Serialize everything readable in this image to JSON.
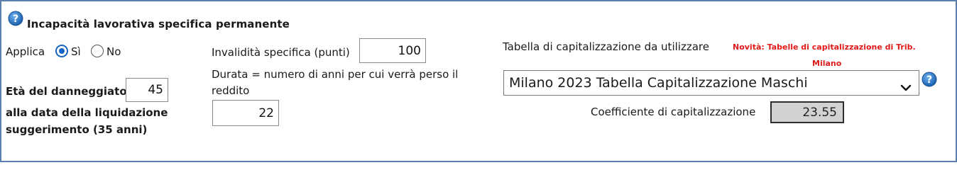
{
  "section": {
    "title": "Incapacità lavorativa specifica permanente"
  },
  "applica": {
    "label": "Applica",
    "options": [
      {
        "label": "Sì",
        "selected": true
      },
      {
        "label": "No",
        "selected": false
      }
    ]
  },
  "eta": {
    "label": "Età del danneggiato",
    "value": "45",
    "label2": "alla data della liquidazione",
    "hint": "suggerimento (35 anni)"
  },
  "invalidita": {
    "label": "Invalidità specifica (punti)",
    "value": "100"
  },
  "durata": {
    "label_line1": "Durata = numero di anni per cui verrà perso il",
    "label_line2": "reddito",
    "value": "22"
  },
  "tabella": {
    "label": "Tabella di capitalizzazione da utilizzare",
    "novita_line1": "Novità: Tabelle di capitalizzazione di Trib.",
    "novita_line2": "Milano",
    "selected": "Milano 2023 Tabella Capitalizzazione Maschi"
  },
  "coefficiente": {
    "label": "Coefficiente di capitalizzazione",
    "value": "23.55"
  },
  "colors": {
    "frame": "#5b7fae",
    "help_icon": "#1f6fc0",
    "radio_selected": "#1565c0",
    "note_red": "#e0191a",
    "coef_bg": "#d2d2d2"
  },
  "icons": [
    "help-icon",
    "chevron-down-icon"
  ]
}
